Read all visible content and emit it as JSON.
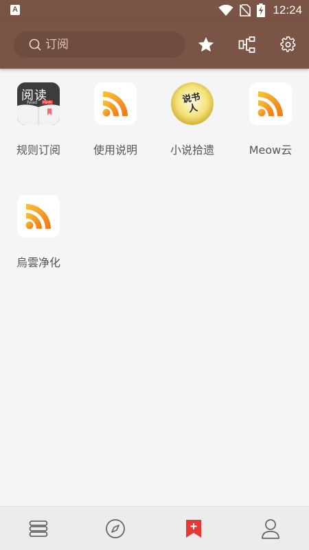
{
  "status": {
    "time": "12:24",
    "app_badge": "A"
  },
  "toolbar": {
    "search_placeholder": "订阅",
    "icons": [
      "star-icon",
      "group-icon",
      "gear-icon"
    ]
  },
  "sources": [
    {
      "label": "规则订阅",
      "icon": "reader-app-icon",
      "badge_text": "阅读",
      "badge_small": "Read",
      "badge_tag": "legado"
    },
    {
      "label": "使用说明",
      "icon": "rss-icon"
    },
    {
      "label": "小说拾遗",
      "icon": "calligraphy-icon",
      "badge_text": "说书人"
    },
    {
      "label": "Meow云",
      "icon": "rss-icon"
    },
    {
      "label": "烏雲净化",
      "icon": "rss-icon"
    }
  ],
  "bottom_nav": [
    "bookshelf-icon",
    "compass-icon",
    "bookmark-add-icon",
    "person-icon"
  ],
  "colors": {
    "toolbar": "#7a5445",
    "accent": "#e53935",
    "rss_start": "#f5b52a",
    "rss_end": "#f27d1b"
  }
}
